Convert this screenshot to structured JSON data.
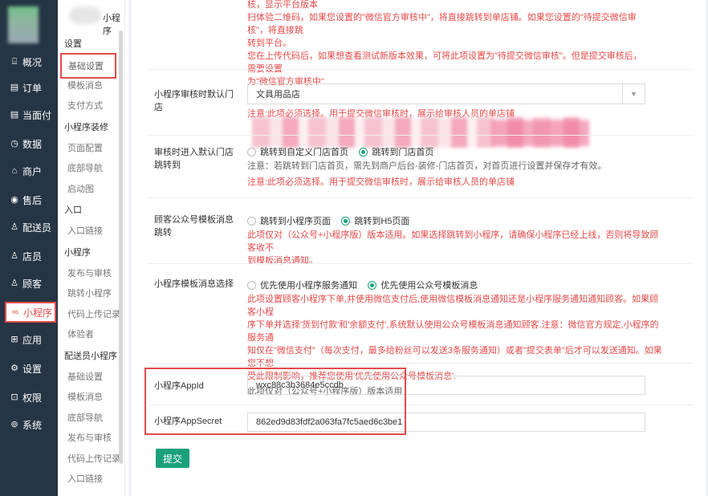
{
  "nav": {
    "items": [
      {
        "icon": "chart-icon",
        "glyph": "⌸",
        "label": "概况"
      },
      {
        "icon": "order-icon",
        "glyph": "▤",
        "label": "订单"
      },
      {
        "icon": "pay-icon",
        "glyph": "▤",
        "label": "当面付"
      },
      {
        "icon": "data-icon",
        "glyph": "◷",
        "label": "数据"
      },
      {
        "icon": "shop-icon",
        "glyph": "⌂",
        "label": "商户"
      },
      {
        "icon": "aftersale-icon",
        "glyph": "◉",
        "label": "售后"
      },
      {
        "icon": "delivery-icon",
        "glyph": "♙",
        "label": "配送员"
      },
      {
        "icon": "clerk-icon",
        "glyph": "♙",
        "label": "店员"
      },
      {
        "icon": "customer-icon",
        "glyph": "♙",
        "label": "顾客"
      },
      {
        "icon": "miniprogram-icon",
        "glyph": "∞",
        "label": "小程序"
      },
      {
        "icon": "apps-icon",
        "glyph": "⊞",
        "label": "应用"
      },
      {
        "icon": "settings-icon",
        "glyph": "⚙",
        "label": "设置"
      },
      {
        "icon": "lock-icon",
        "glyph": "⊡",
        "label": "权限"
      },
      {
        "icon": "system-icon",
        "glyph": "⊚",
        "label": "系统"
      }
    ]
  },
  "sub": {
    "title": "小程序",
    "groups": [
      {
        "label": "设置",
        "links": [
          "基础设置",
          "模板消息",
          "支付方式"
        ]
      },
      {
        "label": "小程序装修",
        "links": [
          "页面配置",
          "底部导航",
          "启动图"
        ]
      },
      {
        "label": "入口",
        "links": [
          "入口链接"
        ]
      },
      {
        "label": "小程序",
        "links": [
          "发布与审核",
          "跳转小程序",
          "代码上传记录",
          "体验者"
        ]
      },
      {
        "label": "配送员小程序",
        "links": [
          "基础设置",
          "模板消息",
          "底部导航",
          "发布与审核",
          "代码上传记录",
          "入口链接"
        ]
      }
    ]
  },
  "top_notes": {
    "line1": "核，显示平台版本",
    "line2": "扫体验二维码，如果您设置的\"微信官方审核中\"，将直接跳转到单店铺。如果您设置的\"待提交微信审核\"，将直接跳",
    "line3": "转到平台。",
    "line4": "您在上传代码后，如果想查看测试新版本效果，可将此项设置为\"待提交微信审核\"。但是提交审核后，需要设置",
    "line5": "为\"微信官方审核中\""
  },
  "review_store": {
    "label_line1": "小程序审核时默认门",
    "label_line2": "店",
    "value": "文具用品店",
    "note": "注意:此项必须选择。用于提交微信审核时，展示给审核人员的单店铺"
  },
  "default_store": {
    "label_line1": "审核时进入默认门店",
    "label_line2": "跳转到",
    "options": [
      "跳转到自定义门店首页",
      "跳转到门店首页"
    ],
    "selected": 1,
    "note": "注意：若跳转到门店首页，需先到商户后台-装修-门店首页，对首页进行设置并保存才有效。",
    "warn": "注意:此项必须选择。用于提交微信审核时，展示给审核人员的单店铺"
  },
  "template_jump": {
    "label_line1": "顾客公众号模板消息",
    "label_line2": "跳转",
    "options": [
      "跳转到小程序页面",
      "跳转到H5页面"
    ],
    "selected": 1,
    "note_line1": "此项仅对（公众号+小程序版）版本适用。如果选择跳转到小程序，请确保小程序已经上线，否则将导致顾客收不",
    "note_line2": "到模板消息通知。"
  },
  "template_choice": {
    "label": "小程序模板消息选择",
    "options": [
      "优先使用小程序服务通知",
      "优先使用公众号模板消息"
    ],
    "selected": 1,
    "note_line1": "此项设置顾客小程序下单,并使用微信支付后,使用微信模板消息通知还是小程序服务通知通知顾客。如果顾客小程",
    "note_line2": "序下单并选择'货到付款'和'余额支付',系统默认使用公众号模板消息通知顾客.注意：微信官方规定,小程序的服务通",
    "note_line3": "知仅在\"微信支付\"（每次支付，最多给粉丝可以发送3条服务通知）或者\"提交表单\"后才可以发送通知。如果您不想",
    "note_line4": "受此限制影响，推荐您使用'优先使用公众号模板消息'.",
    "note_line5": "此项仅对（公众号+小程序版）版本适用"
  },
  "appid": {
    "label": "小程序AppId",
    "value": "wxc88c3b3684e5ccdb"
  },
  "appsecret": {
    "label": "小程序AppSecret",
    "value": "862ed9d83fdf2a063fa7fc5aed6c3be1"
  },
  "submit_label": "提交"
}
